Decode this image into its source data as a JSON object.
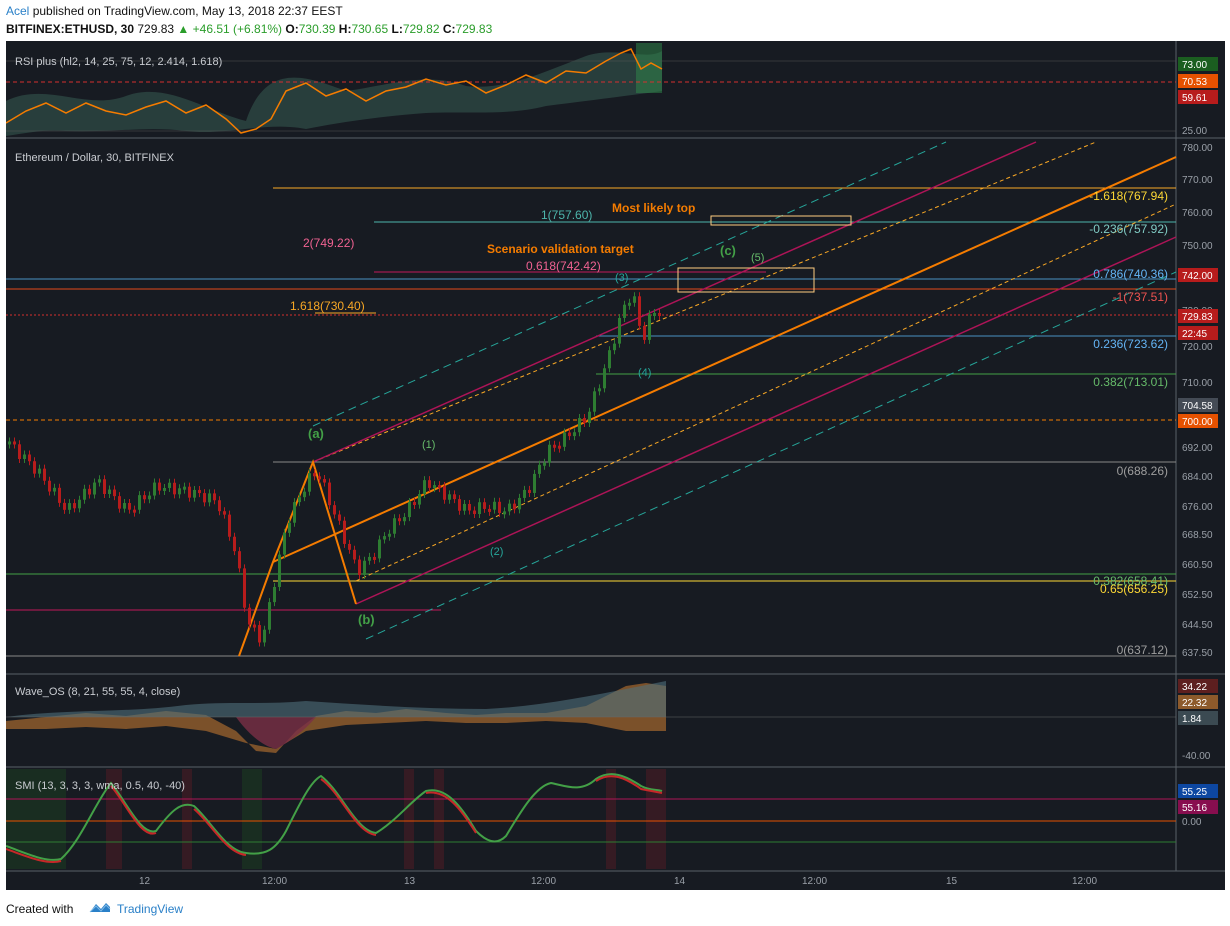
{
  "header": {
    "author": "Acel",
    "published": "published on TradingView.com, May 13, 2018 22:37 EEST",
    "symbol": "BITFINEX:ETHUSD, 30",
    "last": "729.83",
    "change": "+46.51 (+6.81%)",
    "o_label": "O:",
    "o": "730.39",
    "h_label": "H:",
    "h": "730.65",
    "l_label": "L:",
    "l": "729.82",
    "c_label": "C:",
    "c": "729.83"
  },
  "panes": {
    "rsi": {
      "title": "RSI plus (hl2, 14, 25, 75, 12, 2.414, 1.618)",
      "axis": [
        "73.00",
        "70.53",
        "59.61",
        "25.00"
      ]
    },
    "main": {
      "title": "Ethereum / Dollar, 30, BITFINEX",
      "axis": [
        "780.00",
        "770.00",
        "760.00",
        "750.00",
        "740.00",
        "730.00",
        "720.00",
        "710.00",
        "700.00",
        "692.00",
        "684.00",
        "676.00",
        "668.50",
        "660.50",
        "652.50",
        "644.50",
        "637.50"
      ],
      "badges": [
        {
          "text": "742.00",
          "color": "#b71c1c"
        },
        {
          "text": "729.83",
          "color": "#b71c1c"
        },
        {
          "text": "22:45",
          "color": "#b71c1c"
        },
        {
          "text": "704.58",
          "color": "#444b55"
        },
        {
          "text": "700.00",
          "color": "#e65100"
        }
      ]
    },
    "wave": {
      "title": "Wave_OS (8, 21, 55, 55, 4, close)",
      "axis": [
        "34.22",
        "22.32",
        "1.84",
        "-40.00"
      ]
    },
    "smi": {
      "title": "SMI (13, 3, 3, 3, wma, 0.5, 40, -40)",
      "axis": [
        "55.25",
        "55.16",
        "0.00"
      ]
    }
  },
  "annotations": {
    "most_likely_top": "Most likely top",
    "scenario_target": "Scenario validation target",
    "wave_a": "(a)",
    "wave_b": "(b)",
    "wave_c": "(c)",
    "wave_1": "(1)",
    "wave_2": "(2)",
    "wave_3": "(3)",
    "wave_4": "(4)",
    "wave_5": "(5)"
  },
  "fib_labels": {
    "f1618_top": "-1.618(767.94)",
    "f0236_neg": "-0.236(757.92)",
    "f0786": "0.786(740.36)",
    "fneg1": "-1(737.51)",
    "f0236": "0.236(723.62)",
    "f0382": "0.382(713.01)",
    "f0_top": "0(688.26)",
    "f0382_low": "0.382(658.41)",
    "f065": "0.65(656.25)",
    "f0_low": "0(637.12)",
    "ext_1": "1(757.60)",
    "ext_2": "2(749.22)",
    "ext_0618": "0.618(742.42)",
    "ext_1618": "1.618(730.40)"
  },
  "time_axis": [
    "12",
    "12:00",
    "13",
    "12:00",
    "14",
    "12:00",
    "15",
    "12:00"
  ],
  "footer": {
    "created": "Created with",
    "brand": "TradingView"
  }
}
